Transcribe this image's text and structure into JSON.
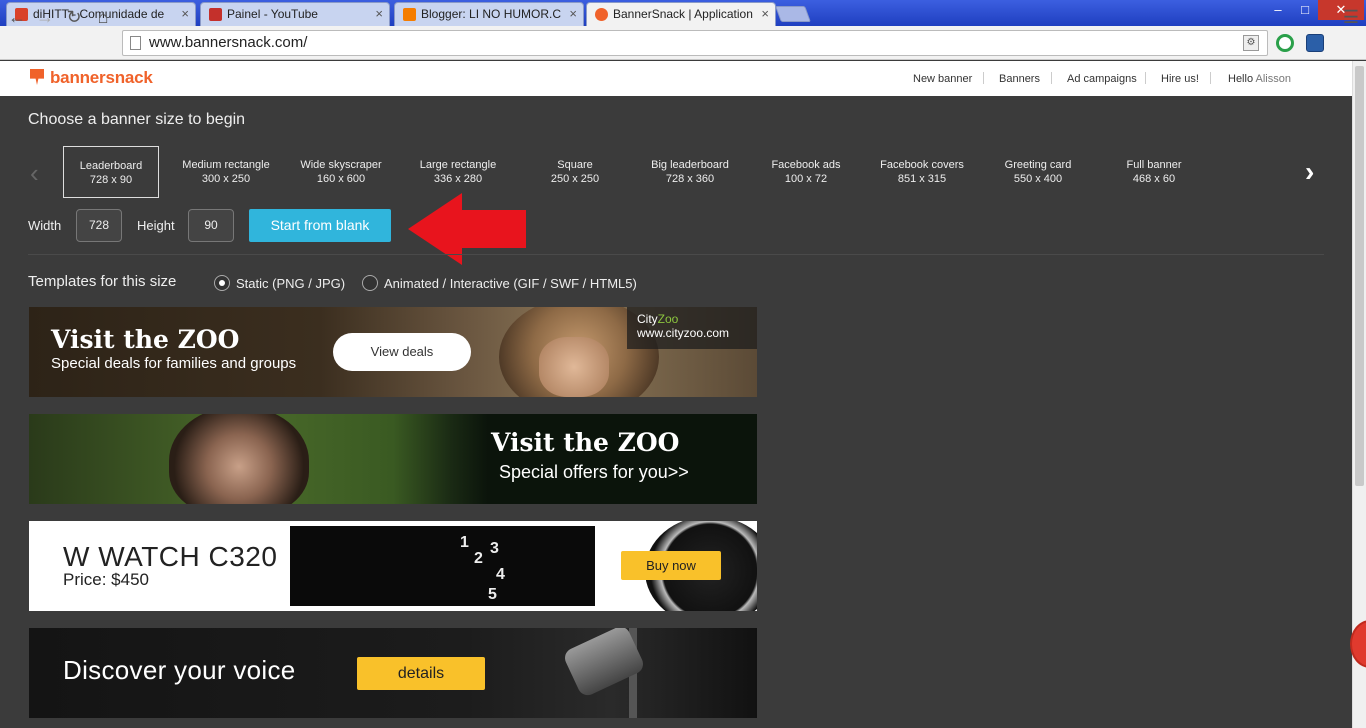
{
  "browser": {
    "tabs": [
      {
        "title": "diHITT - Comunidade de",
        "favicon_color": "#d9412a"
      },
      {
        "title": "Painel - YouTube",
        "favicon_color": "#c4302b"
      },
      {
        "title": "Blogger: LI NO HUMOR.C",
        "favicon_color": "#f57d00"
      },
      {
        "title": "BannerSnack | Application",
        "favicon_color": "#f0622a"
      }
    ],
    "close_glyph": "×",
    "window_controls": {
      "minimize": "‒",
      "maximize": "□",
      "close": "✕"
    },
    "url": "www.bannersnack.com/"
  },
  "site": {
    "logo": "bannersnack",
    "nav": [
      "New banner",
      "Banners",
      "Ad campaigns",
      "Hire us!"
    ],
    "greeting": "Hello",
    "username": "Alisson",
    "accent": "#f0622a"
  },
  "main": {
    "choose_title": "Choose a banner size to begin",
    "sizes": [
      {
        "name": "Leaderboard",
        "dims": "728 x 90"
      },
      {
        "name": "Medium rectangle",
        "dims": "300 x 250"
      },
      {
        "name": "Wide skyscraper",
        "dims": "160 x 600"
      },
      {
        "name": "Large rectangle",
        "dims": "336 x 280"
      },
      {
        "name": "Square",
        "dims": "250 x 250"
      },
      {
        "name": "Big leaderboard",
        "dims": "728 x 360"
      },
      {
        "name": "Facebook ads",
        "dims": "100 x 72"
      },
      {
        "name": "Facebook covers",
        "dims": "851 x 315"
      },
      {
        "name": "Greeting card",
        "dims": "550 x 400"
      },
      {
        "name": "Full banner",
        "dims": "468 x 60"
      }
    ],
    "selected_size": "Leaderboard",
    "width_label": "Width",
    "width_value": "728",
    "height_label": "Height",
    "height_value": "90",
    "start_button": "Start from blank",
    "start_button_color": "#30b5dc",
    "arrow_color": "#e8141d",
    "templates_title": "Templates for this size",
    "radio_static": "Static (PNG / JPG)",
    "radio_animated": "Animated / Interactive (GIF / SWF / HTML5)",
    "selected_template_type": "Static (PNG / JPG)"
  },
  "templates": [
    {
      "headline": "Visit the ZOO",
      "subline": "Special deals for families and groups",
      "button": "View deals",
      "brand_city": "City",
      "brand_zoo": "Zoo",
      "brand_url": "www.cityzoo.com"
    },
    {
      "headline": "Visit the ZOO",
      "subline": "Special offers for you>>"
    },
    {
      "headline": "W WATCH C320",
      "subline": "Price: $450",
      "button": "Buy now",
      "dial_numbers": [
        "1",
        "2",
        "3",
        "4",
        "5"
      ]
    },
    {
      "headline": "Discover your voice",
      "button": "details"
    }
  ]
}
